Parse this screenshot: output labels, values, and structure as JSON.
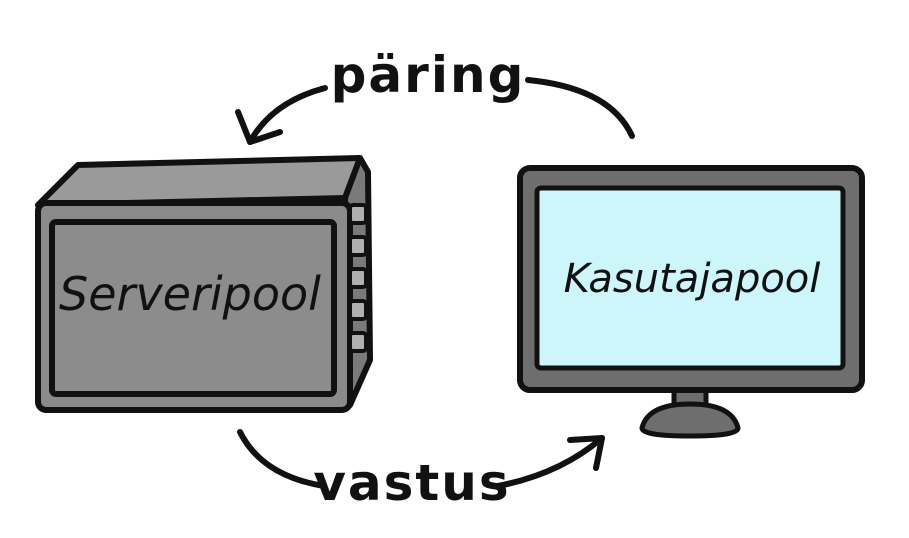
{
  "diagram": {
    "request_label": "päring",
    "response_label": "vastus",
    "server_label": "Serveripool",
    "client_label": "Kasutajapool"
  },
  "colors": {
    "outline": "#111111",
    "server_body": "#8a8a8a",
    "server_top": "#9a9a9a",
    "server_side": "#7a7a7a",
    "server_face": "#8c8c8c",
    "monitor_frame": "#6e6e6e",
    "monitor_screen": "#cdf6fb",
    "stand": "#6e6e6e"
  }
}
